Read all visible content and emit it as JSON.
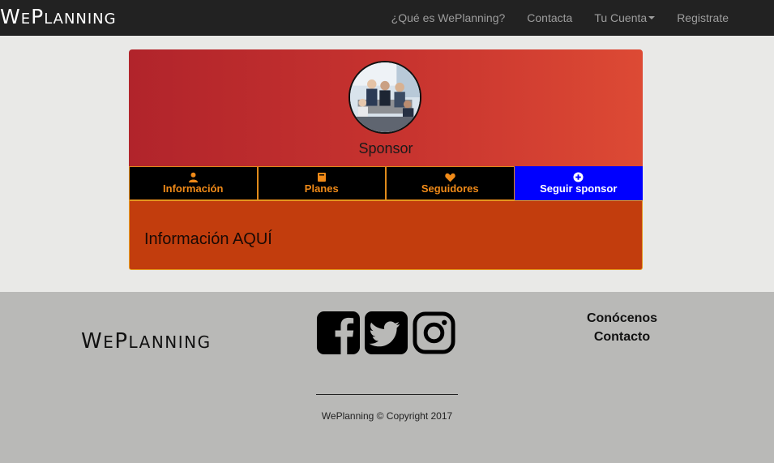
{
  "navbar": {
    "brand_big1": "W",
    "brand_small1": "E",
    "brand_big2": "P",
    "brand_small2": "LANNING",
    "links": [
      {
        "label": "¿Qué es WePlanning?"
      },
      {
        "label": "Contacta"
      },
      {
        "label": "Tu Cuenta",
        "dropdown": true
      },
      {
        "label": "Registrate"
      }
    ]
  },
  "profile": {
    "name": "Sponsor",
    "avatar_icon": "business-meeting-photo"
  },
  "tabs": [
    {
      "label": "Información",
      "icon": "user-icon"
    },
    {
      "label": "Planes",
      "icon": "book-icon"
    },
    {
      "label": "Seguidores",
      "icon": "heart-icon"
    },
    {
      "label": "Seguir sponsor",
      "icon": "plus-circle-icon"
    }
  ],
  "content": {
    "title": "Información AQUÍ"
  },
  "footer": {
    "brand_big1": "W",
    "brand_small1": "E",
    "brand_big2": "P",
    "brand_small2": "LANNING",
    "social": [
      "facebook-icon",
      "twitter-icon",
      "instagram-icon"
    ],
    "links": [
      "Conócenos",
      "Contacto"
    ],
    "copyright": "WePlanning © Copyright 2017"
  },
  "colors": {
    "navbar_bg": "#222222",
    "tab_bg": "#000000",
    "tab_text": "#f08a18",
    "tab_primary_bg": "#0000ff",
    "content_bg": "#c23d0d",
    "header_gradient_start": "#b1242b",
    "header_gradient_end": "#dd4a34"
  }
}
